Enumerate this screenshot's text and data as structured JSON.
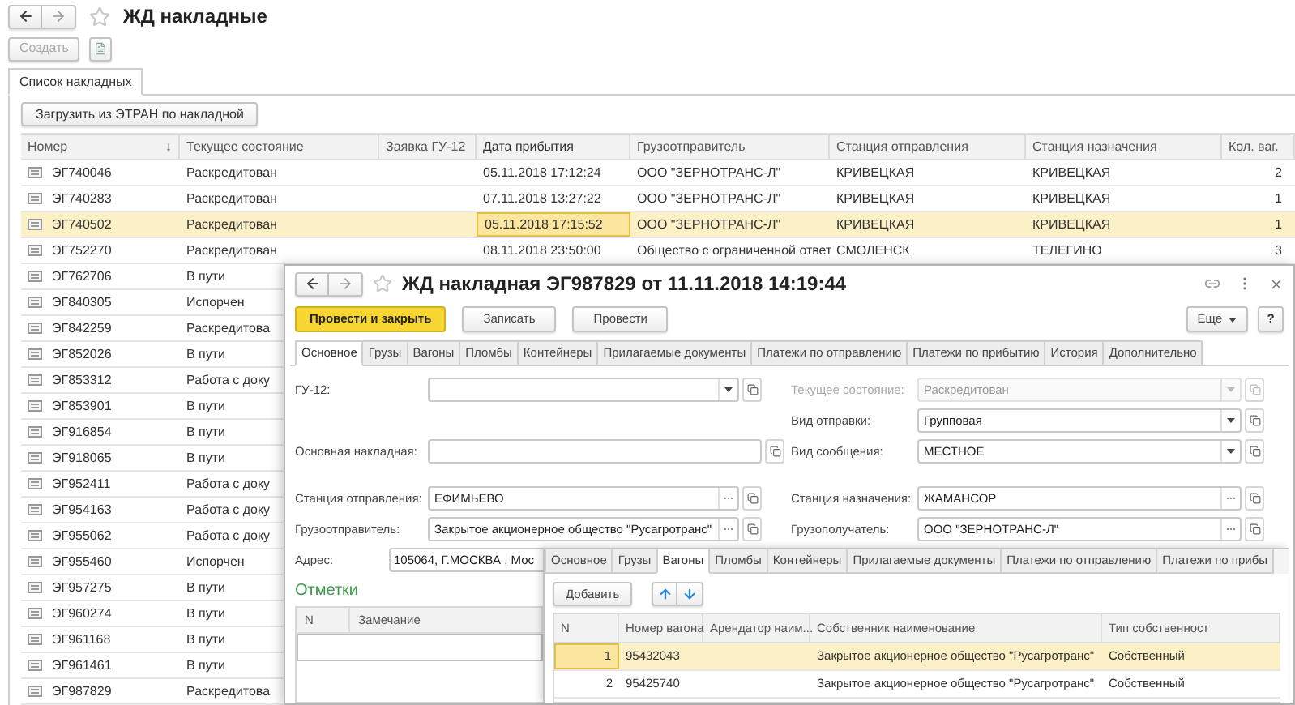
{
  "list_window": {
    "title": "ЖД накладные",
    "create_button": {
      "label": "Создать",
      "disabled": true
    },
    "tabs": [
      {
        "label": "Список накладных",
        "selected": true
      }
    ],
    "load_button": "Загрузить из ЭТРАН по накладной",
    "table": {
      "columns": [
        {
          "label": "Номер",
          "sort_mark": "↓",
          "current": false
        },
        {
          "label": "Текущее состояние",
          "current": false
        },
        {
          "label": "Заявка ГУ-12",
          "current": false
        },
        {
          "label": "Дата прибытия",
          "current": true
        },
        {
          "label": "Грузоотправитель",
          "current": false
        },
        {
          "label": "Станция отправления",
          "current": false
        },
        {
          "label": "Станция назначения",
          "current": false
        },
        {
          "label": "Кол. ваг.",
          "current": false
        }
      ],
      "rows": [
        {
          "selected": false,
          "number": "ЭГ740046",
          "state": "Раскредитован",
          "arrival_date": "05.11.2018 17:12:24",
          "shipper": "ООО \"ЗЕРНОТРАНС-Л\"",
          "from_station": "КРИВЕЦКАЯ",
          "to_station": "КРИВЕЦКАЯ",
          "wagons": "2"
        },
        {
          "selected": false,
          "number": "ЭГ740283",
          "state": "Раскредитован",
          "arrival_date": "07.11.2018 13:27:22",
          "shipper": "ООО \"ЗЕРНОТРАНС-Л\"",
          "from_station": "КРИВЕЦКАЯ",
          "to_station": "КРИВЕЦКАЯ",
          "wagons": "1"
        },
        {
          "selected": true,
          "number": "ЭГ740502",
          "state": "Раскредитован",
          "arrival_date": "05.11.2018 17:15:52",
          "shipper": "ООО \"ЗЕРНОТРАНС-Л\"",
          "from_station": "КРИВЕЦКАЯ",
          "to_station": "КРИВЕЦКАЯ",
          "wagons": "1"
        },
        {
          "selected": false,
          "number": "ЭГ752270",
          "state": "Раскредитован",
          "arrival_date": "08.11.2018 23:50:00",
          "shipper": "Общество с ограниченной ответ",
          "from_station": "СМОЛЕНСК",
          "to_station": "ТЕЛЕГИНО",
          "wagons": "3"
        },
        {
          "selected": false,
          "number": "ЭГ762706",
          "state": "В пути"
        },
        {
          "selected": false,
          "number": "ЭГ840305",
          "state": "Испорчен"
        },
        {
          "selected": false,
          "number": "ЭГ842259",
          "state": "Раскредитова"
        },
        {
          "selected": false,
          "number": "ЭГ852026",
          "state": "В пути"
        },
        {
          "selected": false,
          "number": "ЭГ853312",
          "state": "Работа с доку"
        },
        {
          "selected": false,
          "number": "ЭГ853901",
          "state": "В пути"
        },
        {
          "selected": false,
          "number": "ЭГ916854",
          "state": "В пути"
        },
        {
          "selected": false,
          "number": "ЭГ918065",
          "state": "В пути"
        },
        {
          "selected": false,
          "number": "ЭГ952411",
          "state": "Работа с доку"
        },
        {
          "selected": false,
          "number": "ЭГ954163",
          "state": "Работа с доку"
        },
        {
          "selected": false,
          "number": "ЭГ955062",
          "state": "Работа с доку"
        },
        {
          "selected": false,
          "number": "ЭГ955460",
          "state": "Испорчен"
        },
        {
          "selected": false,
          "number": "ЭГ957275",
          "state": "В пути"
        },
        {
          "selected": false,
          "number": "ЭГ960274",
          "state": "В пути"
        },
        {
          "selected": false,
          "number": "ЭГ961168",
          "state": "В пути"
        },
        {
          "selected": false,
          "number": "ЭГ961461",
          "state": "В пути"
        },
        {
          "selected": false,
          "number": "ЭГ987829",
          "state": "Раскредитова"
        }
      ]
    }
  },
  "form_window": {
    "title": "ЖД накладная ЭГ987829 от 11.11.2018 14:19:44",
    "buttons": [
      {
        "label": "Провести и закрыть",
        "kind": "primary"
      },
      {
        "label": "Записать",
        "kind": "default"
      },
      {
        "label": "Провести",
        "kind": "default"
      }
    ],
    "more_button": "Еще",
    "help_button": "?",
    "tabs": [
      {
        "label": "Основное",
        "selected": true
      },
      {
        "label": "Грузы",
        "selected": false
      },
      {
        "label": "Вагоны",
        "selected": false
      },
      {
        "label": "Пломбы",
        "selected": false
      },
      {
        "label": "Контейнеры",
        "selected": false
      },
      {
        "label": "Прилагаемые документы",
        "selected": false
      },
      {
        "label": "Платежи по отправлению",
        "selected": false
      },
      {
        "label": "Платежи по прибытию",
        "selected": false
      },
      {
        "label": "История",
        "selected": false
      },
      {
        "label": "Дополнительно",
        "selected": false
      }
    ],
    "field_rows": [
      {
        "left": {
          "label": "ГУ-12:",
          "kind": "dropdown",
          "disabled": false
        },
        "right": {
          "label": "Текущее состояние:",
          "value": "Раскредитован",
          "kind": "dropdown",
          "disabled": true
        }
      },
      {
        "right": {
          "label": "Вид отправки:",
          "value": "Групповая",
          "kind": "dropdown",
          "disabled": false
        }
      },
      {
        "left": {
          "label": "Основная накладная:",
          "kind": "link",
          "disabled": false
        },
        "right": {
          "label": "Вид сообщения:",
          "value": "МЕСТНОЕ",
          "kind": "dropdown",
          "disabled": false
        }
      },
      {
        "left": {
          "label": "Станция отправления:",
          "value": "ЕФИМЬЕВО",
          "kind": "select",
          "disabled": false
        },
        "right": {
          "label": "Станция назначения:",
          "value": "ЖАМАНСОР",
          "kind": "select",
          "disabled": false
        }
      },
      {
        "left": {
          "label": "Грузоотправитель:",
          "value": "Закрытое акционерное общество \"Русагротранс\"",
          "kind": "select",
          "disabled": false
        },
        "right": {
          "label": "Грузополучатель:",
          "value": "ООО \"ЗЕРНОТРАНС-Л\"",
          "kind": "select",
          "disabled": false
        }
      }
    ],
    "address": {
      "label": "Адрес:",
      "value": "105064, Г.МОСКВА , Мос"
    },
    "notes": {
      "title": "Отметки",
      "columns": [
        "N",
        "Замечание"
      ]
    },
    "wagons_panel": {
      "tabs": [
        {
          "label": "Основное",
          "selected": false
        },
        {
          "label": "Грузы",
          "selected": false
        },
        {
          "label": "Вагоны",
          "selected": true
        },
        {
          "label": "Пломбы",
          "selected": false
        },
        {
          "label": "Контейнеры",
          "selected": false
        },
        {
          "label": "Прилагаемые документы",
          "selected": false
        },
        {
          "label": "Платежи по отправлению",
          "selected": false
        },
        {
          "label": "Платежи по прибы",
          "selected": false
        }
      ],
      "add_button": "Добавить",
      "table": {
        "columns": [
          "N",
          "Номер вагона",
          "Арендатор наим...",
          "Собственник наименование",
          "Тип собственност"
        ],
        "rows": [
          {
            "selected": true,
            "n": "1",
            "wagon_number": "95432043",
            "owner": "Закрытое акционерное общество \"Русагротранс\"",
            "ownership_type": "Собственный"
          },
          {
            "selected": false,
            "n": "2",
            "wagon_number": "95425740",
            "owner": "Закрытое акционерное общество \"Русагротранс\"",
            "ownership_type": "Собственный"
          }
        ]
      }
    }
  }
}
